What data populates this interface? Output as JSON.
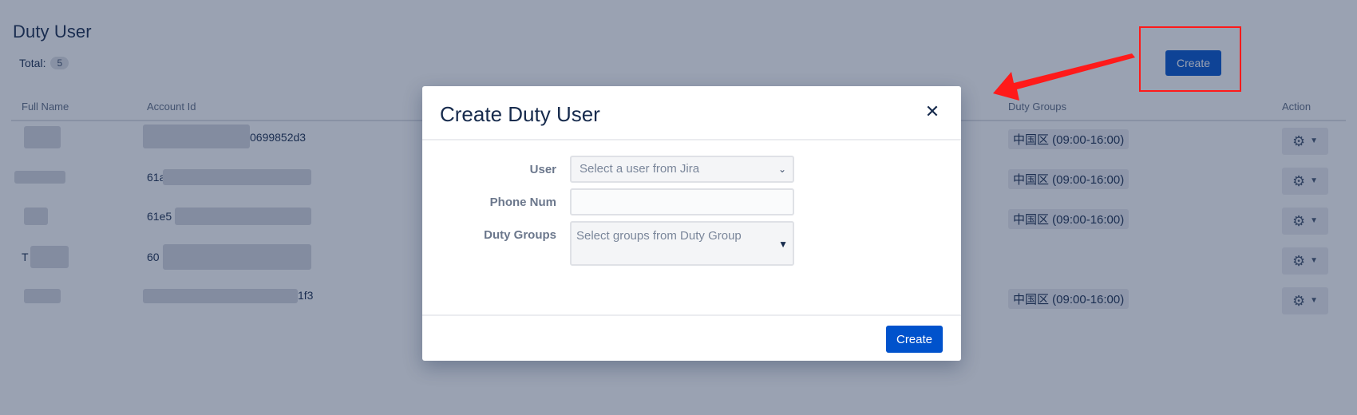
{
  "page": {
    "title": "Duty User",
    "total_label": "Total:",
    "total_count": "5",
    "create_label": "Create"
  },
  "table": {
    "columns": {
      "full_name": "Full Name",
      "account_id": "Account Id",
      "duty_groups": "Duty Groups",
      "action": "Action"
    },
    "rows": [
      {
        "name": "",
        "account": "0699852d3",
        "group": "中国区 (09:00-16:00)"
      },
      {
        "name": "",
        "account": "61a",
        "group": "中国区 (09:00-16:00)"
      },
      {
        "name": "",
        "account": "61e5",
        "group": "中国区 (09:00-16:00)"
      },
      {
        "name": "T",
        "account": "60",
        "group": ""
      },
      {
        "name": "",
        "account": "1f3",
        "group": "中国区 (09:00-16:00)"
      }
    ]
  },
  "icons": {
    "action": "gear-icon",
    "dropdown": "chevron-down-icon",
    "close": "close-icon"
  },
  "modal": {
    "title": "Create Duty User",
    "close_symbol": "✕",
    "fields": {
      "user_label": "User",
      "user_placeholder": "Select a user from Jira",
      "phone_label": "Phone Num",
      "phone_value": "",
      "groups_label": "Duty Groups",
      "groups_placeholder": "Select groups from Duty Group"
    },
    "create_label": "Create"
  },
  "colors": {
    "primary": "#0052cc",
    "annotation_red": "#ff1a1a",
    "overlay": "#203054"
  }
}
